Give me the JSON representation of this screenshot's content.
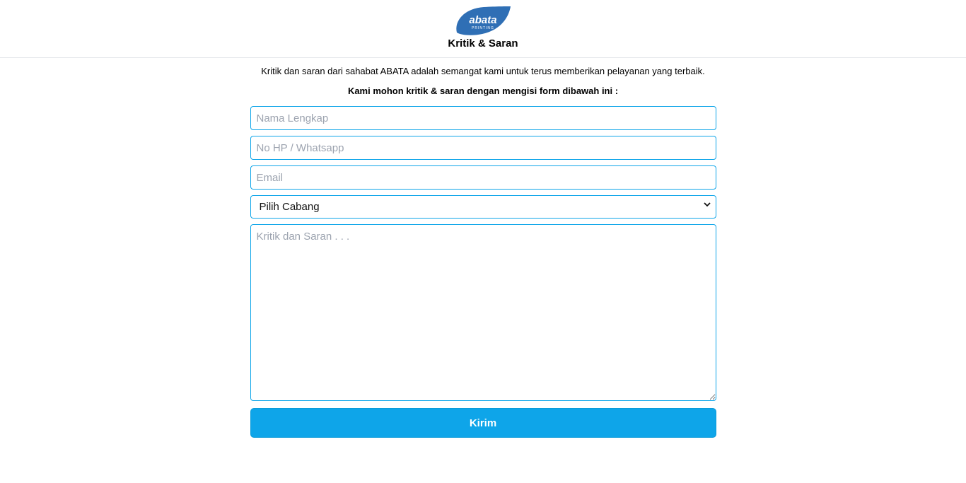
{
  "header": {
    "logo_text": "abata",
    "logo_subtext": "PRINTING",
    "title": "Kritik & Saran"
  },
  "intro_text": "Kritik dan saran dari sahabat ABATA adalah semangat kami untuk terus memberikan pelayanan yang terbaik.",
  "instruction_text": "Kami mohon kritik & saran dengan mengisi form dibawah ini :",
  "form": {
    "name_placeholder": "Nama Lengkap",
    "phone_placeholder": "No HP / Whatsapp",
    "email_placeholder": "Email",
    "branch_selected": "Pilih Cabang",
    "message_placeholder": "Kritik dan Saran . . .",
    "submit_label": "Kirim"
  },
  "colors": {
    "accent": "#0ea5e9",
    "logo_blue": "#2f6fb5"
  }
}
